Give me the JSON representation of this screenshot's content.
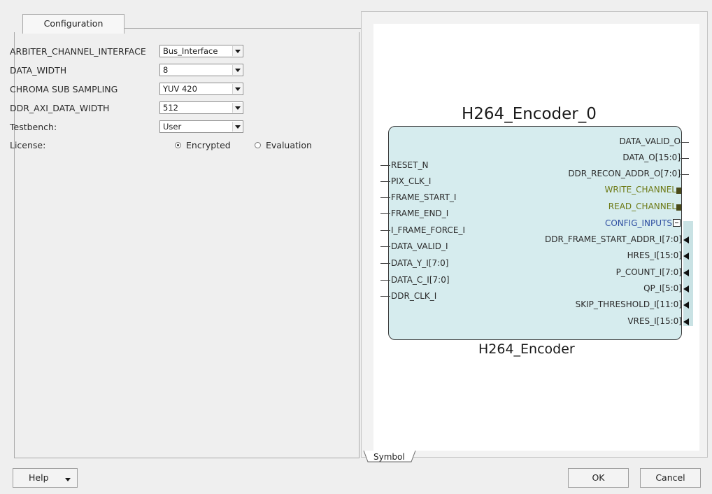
{
  "tabs": {
    "configuration": "Configuration",
    "symbol": "Symbol"
  },
  "params": [
    {
      "label": "ARBITER_CHANNEL_INTERFACE",
      "value": "Bus_Interface"
    },
    {
      "label": "DATA_WIDTH",
      "value": "8"
    },
    {
      "label": "CHROMA SUB SAMPLING",
      "value": "YUV 420"
    },
    {
      "label": "DDR_AXI_DATA_WIDTH",
      "value": "512"
    },
    {
      "label": "Testbench:",
      "value": "User"
    }
  ],
  "license": {
    "label": "License:",
    "options": [
      "Encrypted",
      "Evaluation"
    ],
    "selected": "Encrypted"
  },
  "symbol": {
    "instance_name": "H264_Encoder_0",
    "type_name": "H264_Encoder",
    "inputs": [
      "RESET_N",
      "PIX_CLK_I",
      "FRAME_START_I",
      "FRAME_END_I",
      "I_FRAME_FORCE_I",
      "DATA_VALID_I",
      "DATA_Y_I[7:0]",
      "DATA_C_I[7:0]",
      "DDR_CLK_I"
    ],
    "outputs": [
      "DATA_VALID_O",
      "DATA_O[15:0]",
      "DDR_RECON_ADDR_O[7:0]"
    ],
    "bus_interfaces": [
      "WRITE_CHANNEL",
      "READ_CHANNEL"
    ],
    "config_group": "CONFIG_INPUTS",
    "config_inputs": [
      "DDR_FRAME_START_ADDR_I[7:0]",
      "HRES_I[15:0]",
      "P_COUNT_I[7:0]",
      "QP_I[5:0]",
      "SKIP_THRESHOLD_I[11:0]",
      "VRES_I[15:0]"
    ]
  },
  "buttons": {
    "help": "Help",
    "ok": "OK",
    "cancel": "Cancel"
  },
  "colors": {
    "block_fill": "#d6ecee",
    "bus_pin": "#6d7a16",
    "config_pin": "#2d4da0"
  }
}
